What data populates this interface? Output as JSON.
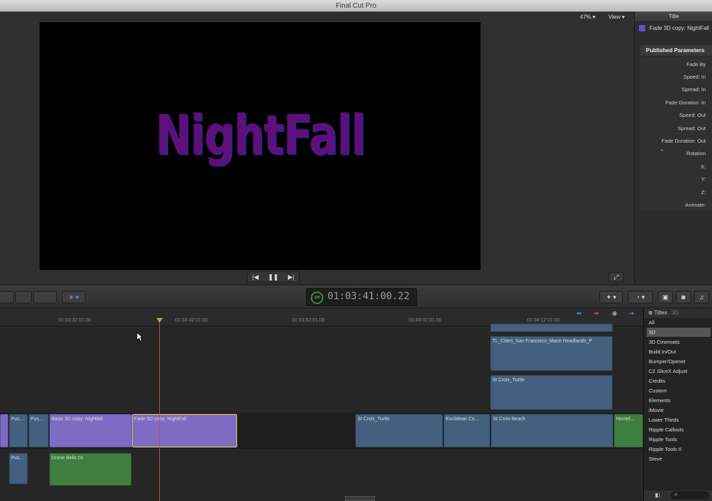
{
  "window": {
    "title": "Final Cut Pro"
  },
  "viewer": {
    "zoom": "47%",
    "view_menu": "View",
    "title_text": "NightFall",
    "transport": {
      "prev": "|◀",
      "play_pause": "❚❚",
      "next": "▶|"
    }
  },
  "inspector": {
    "header": "Title",
    "clip_name": "Fade 3D copy: NightFall",
    "section": "Published Parameters",
    "params": [
      "Fade By",
      "Speed: In",
      "Spread: In",
      "Fade Duration: In",
      "Speed: Out",
      "Spread: Out",
      "Fade Duration: Out",
      "Rotation",
      "X:",
      "Y:",
      "Z:",
      "Animate:"
    ]
  },
  "toolbar": {
    "timecode": "01:03:41:00.22",
    "timecode_badge": "100"
  },
  "timeline": {
    "ruler": [
      "01:03:32:01.00",
      "01:03:42:01.00",
      "01:03:52:01.00",
      "01:04:02:01.00",
      "01:04:12:01.00"
    ],
    "connected_clips_top": [
      {
        "label": "TL_Cities_San Francisco_Marin Headlands_P"
      },
      {
        "label": "St Croix_Turtle"
      }
    ],
    "primary_clips": [
      {
        "label": "Pus...",
        "color": "blue"
      },
      {
        "label": "Pus...",
        "color": "blue"
      },
      {
        "label": "Basic 3D copy: Nightfall",
        "color": "purple"
      },
      {
        "label": "Fade 3D copy: NightFall",
        "color": "purple",
        "selected": true
      },
      {
        "label": "St Croix_Turtle",
        "color": "blue"
      },
      {
        "label": "Euclidean Co...",
        "color": "blue"
      },
      {
        "label": "St Croix Beach",
        "color": "blue"
      },
      {
        "label": "Homel...",
        "color": "green"
      }
    ],
    "audio_clips": [
      {
        "label": "Pus...",
        "color": "blue"
      },
      {
        "label": "Drone Bells 01",
        "color": "green"
      }
    ]
  },
  "browser": {
    "header": "Titles",
    "header_sub": "3D",
    "categories": [
      "All",
      "3D",
      "3D Cinematic",
      "Build In/Out",
      "Bumper/Opener",
      "C2 SliceX Adjust",
      "Credits",
      "Custom",
      "Elements",
      "iMovie",
      "Lower Thirds",
      "Ripple Callouts",
      "Ripple Tools",
      "Ripple Tools II",
      "Steve"
    ],
    "selected": "3D"
  }
}
